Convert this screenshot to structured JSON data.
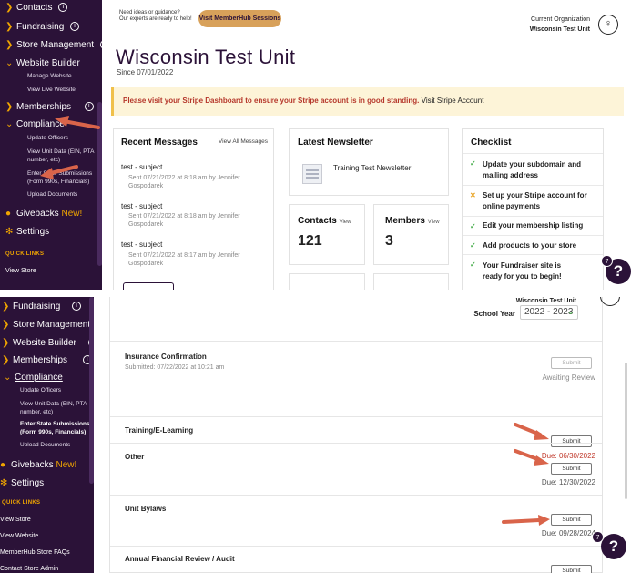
{
  "top": {
    "sidebar": {
      "items": [
        {
          "label": "Contacts",
          "info": "i"
        },
        {
          "label": "Fundraising",
          "info": "i"
        },
        {
          "label": "Store Management",
          "info": "i"
        },
        {
          "label": "Website Builder"
        },
        {
          "label": "Memberships",
          "info": "i"
        },
        {
          "label": "Compliance"
        }
      ],
      "website_sub": [
        "Manage Website",
        "View Live Website"
      ],
      "compliance_sub": [
        "Update Officers",
        "View Unit Data (EIN, PTA number, etc)",
        "Enter State Submissions (Form 990s, Financials)",
        "Upload Documents"
      ],
      "givebacks": "Givebacks",
      "new": "New!",
      "settings": "Settings",
      "quick_links": "QUICK LINKS",
      "view_store": "View Store"
    },
    "tip_line1": "Need ideas or guidance?",
    "tip_line2": "Our experts are ready to help!",
    "hub_button": "Visit MemberHub Sessions",
    "org_label": "Current Organization",
    "org_name": "Wisconsin Test Unit",
    "unit_title": "Wisconsin Test Unit",
    "since": "Since 07/01/2022",
    "alert_warn": "Please visit your Stripe Dashboard to ensure your Stripe account is in good standing.",
    "alert_link": "Visit Stripe Account",
    "messages": {
      "title": "Recent Messages",
      "view_all": "View All Messages",
      "items": [
        {
          "subject": "test - subject",
          "meta": "Sent 07/21/2022 at 8:18 am by Jennifer Gospodarek"
        },
        {
          "subject": "test - subject",
          "meta": "Sent 07/21/2022 at 8:18 am by Jennifer Gospodarek"
        },
        {
          "subject": "test - subject",
          "meta": "Sent 07/21/2022 at 8:17 am by Jennifer Gospodarek"
        }
      ]
    },
    "newsletter": {
      "title": "Latest Newsletter",
      "name": "Training Test Newsletter"
    },
    "contacts": {
      "title": "Contacts",
      "view": "View",
      "value": "121"
    },
    "members": {
      "title": "Members",
      "view": "View",
      "value": "3"
    },
    "checklist": {
      "title": "Checklist",
      "items": [
        {
          "text": "Update your subdomain and mailing address",
          "mark": "✓"
        },
        {
          "text": "Set up your Stripe account for online payments",
          "mark": "✕"
        },
        {
          "text": "Edit your membership listing",
          "mark": "✓"
        },
        {
          "text": "Add products to your store",
          "mark": "✓"
        },
        {
          "text": "Your Fundraiser site is ready for you to begin!",
          "mark": "✓"
        }
      ]
    },
    "help_badge": "7",
    "help_label": "?"
  },
  "bottom": {
    "sidebar": {
      "items": [
        {
          "label": "Fundraising",
          "info": "i"
        },
        {
          "label": "Store Management",
          "info": "i"
        },
        {
          "label": "Website Builder",
          "info": "i"
        },
        {
          "label": "Memberships",
          "info": "i"
        },
        {
          "label": "Compliance"
        }
      ],
      "compliance_sub": [
        "Update Officers",
        "View Unit Data (EIN, PTA number, etc)",
        "Enter State Submissions (Form 990s, Financials)",
        "Upload Documents"
      ],
      "givebacks": "Givebacks",
      "new": "New!",
      "settings": "Settings",
      "quick_links": "QUICK LINKS",
      "links": [
        "View Store",
        "View Website",
        "MemberHub Store FAQs",
        "Contact Store Admin"
      ]
    },
    "org_name": "Wisconsin Test Unit",
    "school_year_label": "School Year",
    "school_year_value": "2022 - 2023",
    "rows": [
      {
        "title": "Insurance Confirmation",
        "subtitle": "Submitted: 07/22/2022 at 10:21 am",
        "button": "Submit",
        "status": "Awaiting Review"
      },
      {
        "title": "Training/E-Learning",
        "button": "Submit",
        "due": "Due: 06/30/2022"
      },
      {
        "title": "Other",
        "button": "Submit",
        "due": "Due: 12/30/2022"
      },
      {
        "title": "Unit Bylaws",
        "button": "Submit",
        "due": "Due: 09/28/2024"
      },
      {
        "title": "Annual Financial Review / Audit",
        "button": "Submit"
      }
    ],
    "help_badge": "7",
    "help_label": "?"
  },
  "colors": {
    "sidebar": "#2b1238",
    "accent": "#f0a500",
    "alert_bg": "#fdf4d8",
    "warn": "#b5362a",
    "arrow": "#d9644a",
    "check": "#4caf50"
  }
}
